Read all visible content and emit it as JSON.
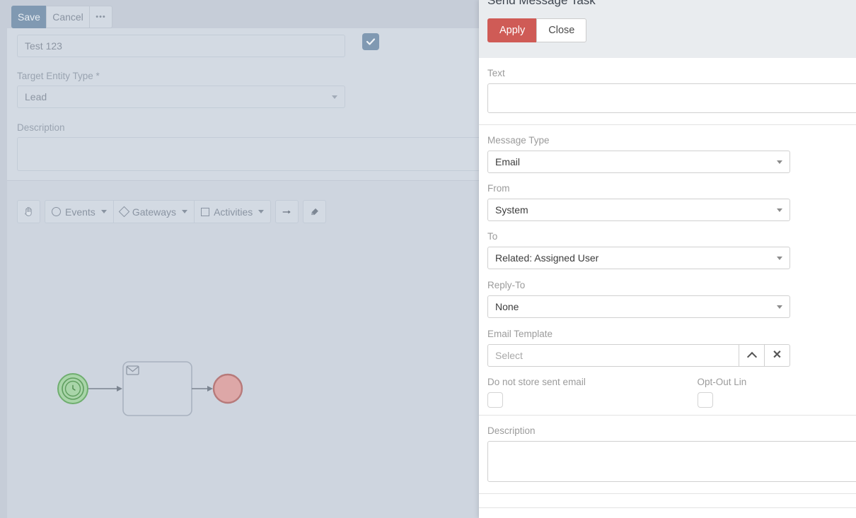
{
  "backdrop": {
    "toolbar": {
      "save_label": "Save",
      "cancel_label": "Cancel",
      "more_label": "•••"
    },
    "name_field": {
      "value": "Test 123"
    },
    "active_checkbox": {
      "checked": true,
      "icon": "check-icon"
    },
    "target_entity_type": {
      "label": "Target Entity Type *",
      "value": "Lead"
    },
    "description": {
      "label": "Description",
      "value": ""
    },
    "diagram_toolbar": {
      "hand_icon": "hand-icon",
      "events_label": "Events",
      "gateways_label": "Gateways",
      "activities_label": "Activities",
      "flow_icon": "arrow-right-icon",
      "eraser_icon": "eraser-icon"
    },
    "diagram": {
      "start_event": "timer-start-event",
      "task": "send-message-task",
      "task_icon": "envelope-icon",
      "end_event": "end-event"
    }
  },
  "panel": {
    "title": "Send Message Task",
    "apply_label": "Apply",
    "close_label": "Close",
    "fields": {
      "text": {
        "label": "Text",
        "value": ""
      },
      "message_type": {
        "label": "Message Type",
        "value": "Email"
      },
      "from": {
        "label": "From",
        "value": "System"
      },
      "to": {
        "label": "To",
        "value": "Related: Assigned User"
      },
      "reply_to": {
        "label": "Reply-To",
        "value": "None"
      },
      "email_template": {
        "label": "Email Template",
        "placeholder": "Select",
        "value": "",
        "up_icon": "chevron-up-icon",
        "clear_icon": "close-x-icon"
      },
      "do_not_store": {
        "label": "Do not store sent email",
        "checked": false
      },
      "opt_out_link": {
        "label": "Opt-Out Lin",
        "checked": false
      },
      "description": {
        "label": "Description",
        "value": ""
      }
    }
  },
  "colors": {
    "accent_apply": "#cf5b56",
    "canvas_bg": "#ced5df",
    "panel_header_bg": "#e9ecef",
    "checkbox_on": "#8099b2",
    "start_event": "#a7d5a7",
    "end_event": "#dda5a5"
  }
}
